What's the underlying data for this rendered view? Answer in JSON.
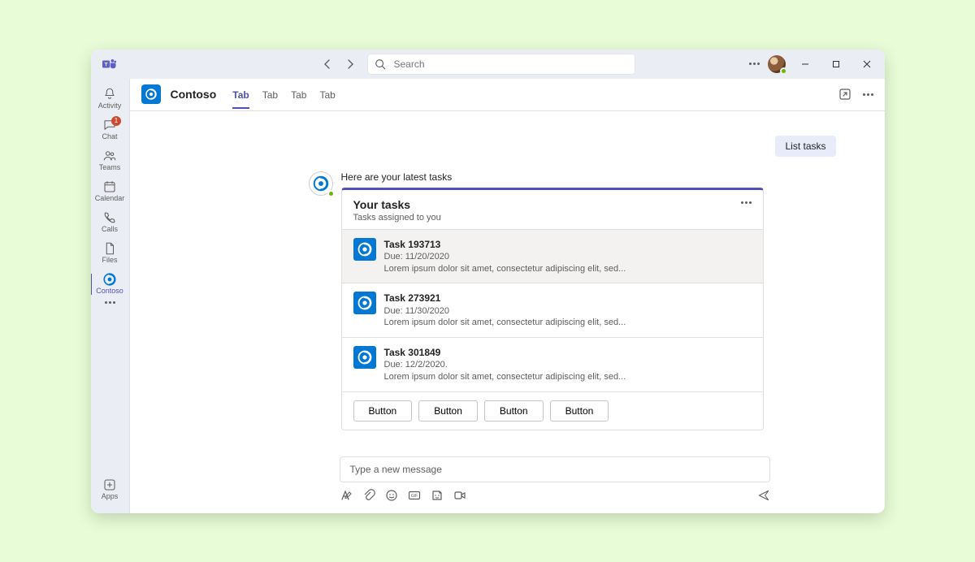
{
  "search": {
    "placeholder": "Search"
  },
  "rail": {
    "items": [
      {
        "key": "activity",
        "label": "Activity"
      },
      {
        "key": "chat",
        "label": "Chat",
        "badge": "1"
      },
      {
        "key": "teams",
        "label": "Teams"
      },
      {
        "key": "calendar",
        "label": "Calendar"
      },
      {
        "key": "calls",
        "label": "Calls"
      },
      {
        "key": "files",
        "label": "Files"
      },
      {
        "key": "contoso",
        "label": "Contoso"
      }
    ],
    "apps_label": "Apps"
  },
  "header": {
    "app_name": "Contoso",
    "tabs": [
      "Tab",
      "Tab",
      "Tab",
      "Tab"
    ]
  },
  "chat": {
    "user_pill": "List tasks",
    "bot_intro": "Here are your latest tasks",
    "card": {
      "title": "Your tasks",
      "subtitle": "Tasks assigned to you",
      "tasks": [
        {
          "title": "Task 193713",
          "due": "Due: 11/20/2020",
          "desc": "Lorem ipsum dolor sit amet, consectetur adipiscing elit, sed..."
        },
        {
          "title": "Task 273921",
          "due": "Due: 11/30/2020",
          "desc": "Lorem ipsum dolor sit amet, consectetur adipiscing elit, sed..."
        },
        {
          "title": "Task 301849",
          "due": "Due: 12/2/2020.",
          "desc": "Lorem ipsum dolor sit amet, consectetur adipiscing elit, sed..."
        }
      ],
      "buttons": [
        "Button",
        "Button",
        "Button",
        "Button"
      ]
    }
  },
  "composer": {
    "placeholder": "Type a new message"
  }
}
